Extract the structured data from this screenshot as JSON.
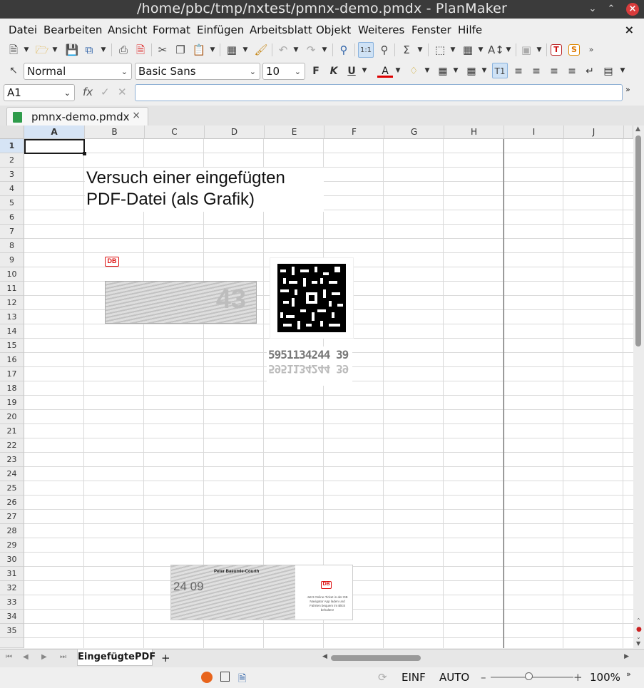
{
  "window": {
    "title": "/home/pbc/tmp/nxtest/pmnx-demo.pmdx - PlanMaker"
  },
  "menu": {
    "items": [
      "Datei",
      "Bearbeiten",
      "Ansicht",
      "Format",
      "Einfügen",
      "Arbeitsblatt",
      "Objekt",
      "Weiteres",
      "Fenster",
      "Hilfe"
    ]
  },
  "format": {
    "style": "Normal",
    "font": "Basic Sans",
    "size": "10"
  },
  "formula": {
    "cell_ref": "A1",
    "fx": "fx",
    "content": ""
  },
  "document_tab": {
    "label": "pmnx-demo.pmdx"
  },
  "grid": {
    "columns": [
      "A",
      "B",
      "C",
      "D",
      "E",
      "F",
      "G",
      "H",
      "I",
      "J"
    ],
    "rows": [
      "1",
      "2",
      "3",
      "4",
      "5",
      "6",
      "7",
      "8",
      "9",
      "10",
      "11",
      "12",
      "13",
      "14",
      "15",
      "16",
      "17",
      "18",
      "19",
      "20",
      "21",
      "22",
      "23",
      "24",
      "25",
      "26",
      "27",
      "28",
      "29",
      "30",
      "31",
      "32",
      "33",
      "34",
      "35"
    ],
    "active_cell": "A1"
  },
  "objects": {
    "text_line1": "Versuch einer eingefügten",
    "text_line2": "PDF-Datei (als Grafik)",
    "db_logo": "DB",
    "ticket_number": "5951134244 39",
    "ticket_number_text": "5951134244 39",
    "passenger_name": "Peter Baeumle-Courth",
    "ticket_date": "24 09",
    "promo_text": "Jetzt Online-Ticket in der DB Navigator App laden und Fahrten bequem im Blick behalten!",
    "stamp_big": "43"
  },
  "sheet_tabs": {
    "active": "EingefügtePDF",
    "add": "+"
  },
  "status": {
    "mode_ins": "EINF",
    "mode_calc": "AUTO",
    "zoom_minus": "–",
    "zoom_plus": "+",
    "zoom": "100%"
  }
}
